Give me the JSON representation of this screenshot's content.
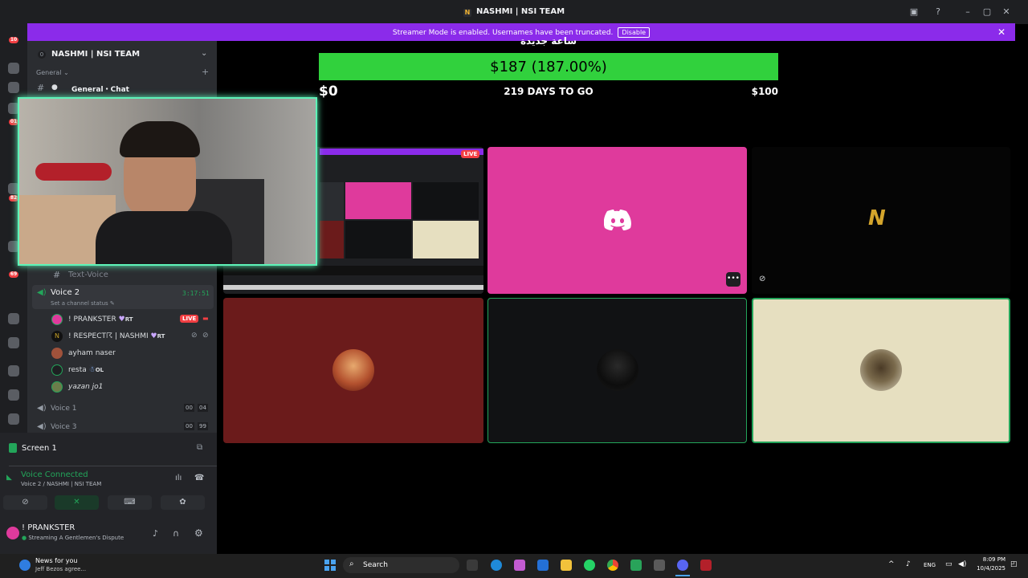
{
  "window": {
    "title": "NASHMI | NSI TEAM"
  },
  "banner": {
    "text": "Streamer Mode is enabled. Usernames have been truncated.",
    "button": "Disable"
  },
  "sidebar": {
    "server_name": "NASHMI | NSI TEAM",
    "category": "General",
    "general_chat": "General・Chat",
    "text_voice": "Text-Voice",
    "voice2": {
      "name": "Voice 2",
      "timer": "3:17:51",
      "status": "Set a channel status"
    },
    "members": [
      {
        "name": "! PRANKSTER",
        "tag": "RT",
        "badge": "LIVE"
      },
      {
        "name": "! RESPECT☈ | NASHMI",
        "tag": "RT"
      },
      {
        "name": "ayham naser"
      },
      {
        "name": "resta",
        "tag": "OL"
      },
      {
        "name": "yazan jo1"
      }
    ],
    "voice1": {
      "name": "Voice 1",
      "count_a": "00",
      "count_b": "04"
    },
    "voice3": {
      "name": "Voice 3",
      "count_a": "00",
      "count_b": "99"
    },
    "rail_badges": [
      "10",
      "01",
      "82",
      "69"
    ]
  },
  "bottom": {
    "screen": "Screen 1",
    "voice_connected": "Voice Connected",
    "voice_channel": "Voice 2 / NASHMI | NSI TEAM",
    "user": "! PRANKSTER",
    "user_status": "Streaming A Gentlemen's Dispute"
  },
  "stream": {
    "arabic_title": "ساعة جديدة",
    "progress_label": "$187 (187.00%)",
    "progress_fraction": 1.0,
    "min": "$0",
    "days": "219 DAYS TO GO",
    "max": "$100",
    "live": "LIVE"
  },
  "taskbar": {
    "news_title": "News for you",
    "news_sub": "Jeff Bezos agree...",
    "search": "Search",
    "lang": "ENG",
    "time": "8:09 PM",
    "date": "10/4/2025"
  },
  "colors": {
    "accent": "#8b2bea",
    "discord_pink": "#df3a9c",
    "green": "#23a55a",
    "live_red": "#f23f43",
    "speaking": "#5ef3b8"
  }
}
